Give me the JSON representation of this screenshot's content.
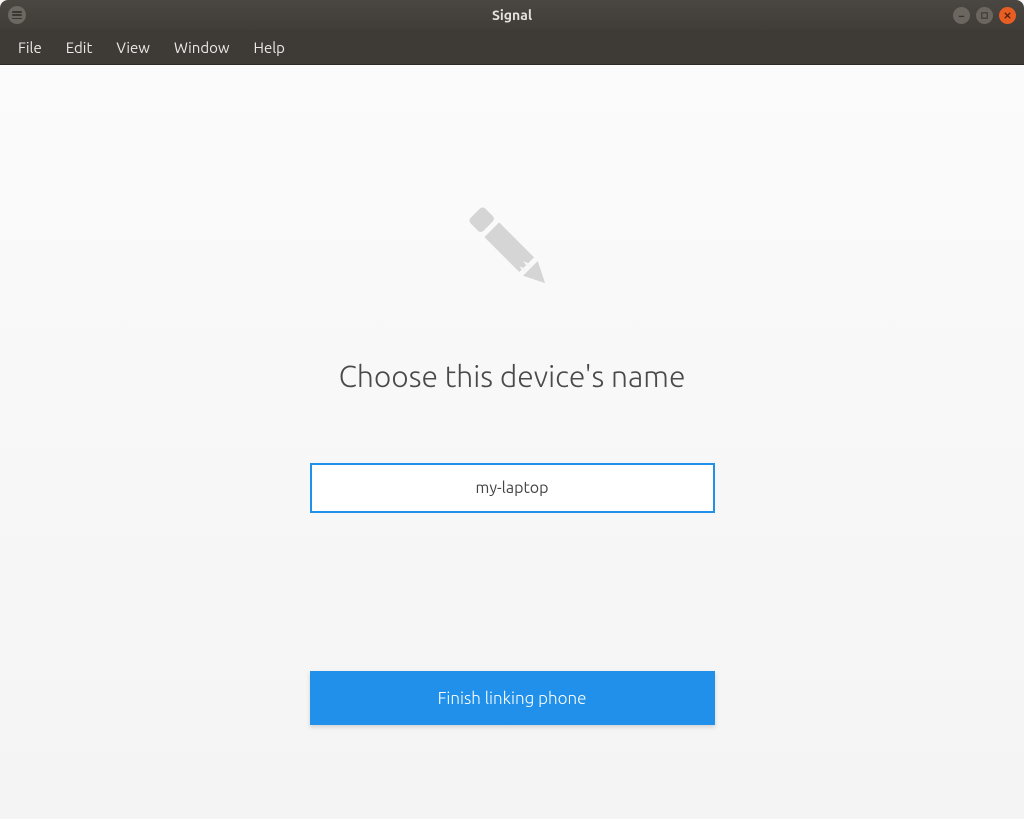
{
  "window": {
    "title": "Signal"
  },
  "menubar": {
    "items": [
      "File",
      "Edit",
      "View",
      "Window",
      "Help"
    ]
  },
  "main": {
    "heading": "Choose this device's name",
    "device_name_value": "my-laptop",
    "finish_button_label": "Finish linking phone"
  },
  "icons": {
    "app_menu": "menu-icon",
    "pencil": "pencil-icon",
    "minimize": "minimize-icon",
    "maximize": "maximize-icon",
    "close": "close-icon"
  },
  "colors": {
    "accent": "#2090ea",
    "titlebar": "#413e39",
    "close_button": "#e85d22"
  }
}
